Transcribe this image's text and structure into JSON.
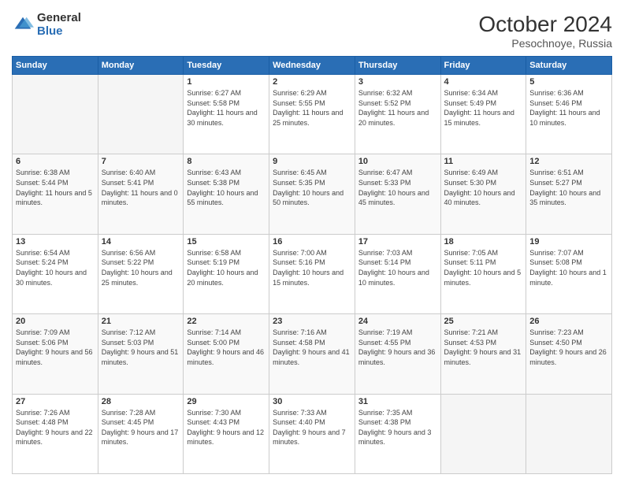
{
  "logo": {
    "general": "General",
    "blue": "Blue"
  },
  "title": "October 2024",
  "location": "Pesochnoye, Russia",
  "headers": [
    "Sunday",
    "Monday",
    "Tuesday",
    "Wednesday",
    "Thursday",
    "Friday",
    "Saturday"
  ],
  "weeks": [
    [
      {
        "day": "",
        "sunrise": "",
        "sunset": "",
        "daylight": ""
      },
      {
        "day": "",
        "sunrise": "",
        "sunset": "",
        "daylight": ""
      },
      {
        "day": "1",
        "sunrise": "Sunrise: 6:27 AM",
        "sunset": "Sunset: 5:58 PM",
        "daylight": "Daylight: 11 hours and 30 minutes."
      },
      {
        "day": "2",
        "sunrise": "Sunrise: 6:29 AM",
        "sunset": "Sunset: 5:55 PM",
        "daylight": "Daylight: 11 hours and 25 minutes."
      },
      {
        "day": "3",
        "sunrise": "Sunrise: 6:32 AM",
        "sunset": "Sunset: 5:52 PM",
        "daylight": "Daylight: 11 hours and 20 minutes."
      },
      {
        "day": "4",
        "sunrise": "Sunrise: 6:34 AM",
        "sunset": "Sunset: 5:49 PM",
        "daylight": "Daylight: 11 hours and 15 minutes."
      },
      {
        "day": "5",
        "sunrise": "Sunrise: 6:36 AM",
        "sunset": "Sunset: 5:46 PM",
        "daylight": "Daylight: 11 hours and 10 minutes."
      }
    ],
    [
      {
        "day": "6",
        "sunrise": "Sunrise: 6:38 AM",
        "sunset": "Sunset: 5:44 PM",
        "daylight": "Daylight: 11 hours and 5 minutes."
      },
      {
        "day": "7",
        "sunrise": "Sunrise: 6:40 AM",
        "sunset": "Sunset: 5:41 PM",
        "daylight": "Daylight: 11 hours and 0 minutes."
      },
      {
        "day": "8",
        "sunrise": "Sunrise: 6:43 AM",
        "sunset": "Sunset: 5:38 PM",
        "daylight": "Daylight: 10 hours and 55 minutes."
      },
      {
        "day": "9",
        "sunrise": "Sunrise: 6:45 AM",
        "sunset": "Sunset: 5:35 PM",
        "daylight": "Daylight: 10 hours and 50 minutes."
      },
      {
        "day": "10",
        "sunrise": "Sunrise: 6:47 AM",
        "sunset": "Sunset: 5:33 PM",
        "daylight": "Daylight: 10 hours and 45 minutes."
      },
      {
        "day": "11",
        "sunrise": "Sunrise: 6:49 AM",
        "sunset": "Sunset: 5:30 PM",
        "daylight": "Daylight: 10 hours and 40 minutes."
      },
      {
        "day": "12",
        "sunrise": "Sunrise: 6:51 AM",
        "sunset": "Sunset: 5:27 PM",
        "daylight": "Daylight: 10 hours and 35 minutes."
      }
    ],
    [
      {
        "day": "13",
        "sunrise": "Sunrise: 6:54 AM",
        "sunset": "Sunset: 5:24 PM",
        "daylight": "Daylight: 10 hours and 30 minutes."
      },
      {
        "day": "14",
        "sunrise": "Sunrise: 6:56 AM",
        "sunset": "Sunset: 5:22 PM",
        "daylight": "Daylight: 10 hours and 25 minutes."
      },
      {
        "day": "15",
        "sunrise": "Sunrise: 6:58 AM",
        "sunset": "Sunset: 5:19 PM",
        "daylight": "Daylight: 10 hours and 20 minutes."
      },
      {
        "day": "16",
        "sunrise": "Sunrise: 7:00 AM",
        "sunset": "Sunset: 5:16 PM",
        "daylight": "Daylight: 10 hours and 15 minutes."
      },
      {
        "day": "17",
        "sunrise": "Sunrise: 7:03 AM",
        "sunset": "Sunset: 5:14 PM",
        "daylight": "Daylight: 10 hours and 10 minutes."
      },
      {
        "day": "18",
        "sunrise": "Sunrise: 7:05 AM",
        "sunset": "Sunset: 5:11 PM",
        "daylight": "Daylight: 10 hours and 5 minutes."
      },
      {
        "day": "19",
        "sunrise": "Sunrise: 7:07 AM",
        "sunset": "Sunset: 5:08 PM",
        "daylight": "Daylight: 10 hours and 1 minute."
      }
    ],
    [
      {
        "day": "20",
        "sunrise": "Sunrise: 7:09 AM",
        "sunset": "Sunset: 5:06 PM",
        "daylight": "Daylight: 9 hours and 56 minutes."
      },
      {
        "day": "21",
        "sunrise": "Sunrise: 7:12 AM",
        "sunset": "Sunset: 5:03 PM",
        "daylight": "Daylight: 9 hours and 51 minutes."
      },
      {
        "day": "22",
        "sunrise": "Sunrise: 7:14 AM",
        "sunset": "Sunset: 5:00 PM",
        "daylight": "Daylight: 9 hours and 46 minutes."
      },
      {
        "day": "23",
        "sunrise": "Sunrise: 7:16 AM",
        "sunset": "Sunset: 4:58 PM",
        "daylight": "Daylight: 9 hours and 41 minutes."
      },
      {
        "day": "24",
        "sunrise": "Sunrise: 7:19 AM",
        "sunset": "Sunset: 4:55 PM",
        "daylight": "Daylight: 9 hours and 36 minutes."
      },
      {
        "day": "25",
        "sunrise": "Sunrise: 7:21 AM",
        "sunset": "Sunset: 4:53 PM",
        "daylight": "Daylight: 9 hours and 31 minutes."
      },
      {
        "day": "26",
        "sunrise": "Sunrise: 7:23 AM",
        "sunset": "Sunset: 4:50 PM",
        "daylight": "Daylight: 9 hours and 26 minutes."
      }
    ],
    [
      {
        "day": "27",
        "sunrise": "Sunrise: 7:26 AM",
        "sunset": "Sunset: 4:48 PM",
        "daylight": "Daylight: 9 hours and 22 minutes."
      },
      {
        "day": "28",
        "sunrise": "Sunrise: 7:28 AM",
        "sunset": "Sunset: 4:45 PM",
        "daylight": "Daylight: 9 hours and 17 minutes."
      },
      {
        "day": "29",
        "sunrise": "Sunrise: 7:30 AM",
        "sunset": "Sunset: 4:43 PM",
        "daylight": "Daylight: 9 hours and 12 minutes."
      },
      {
        "day": "30",
        "sunrise": "Sunrise: 7:33 AM",
        "sunset": "Sunset: 4:40 PM",
        "daylight": "Daylight: 9 hours and 7 minutes."
      },
      {
        "day": "31",
        "sunrise": "Sunrise: 7:35 AM",
        "sunset": "Sunset: 4:38 PM",
        "daylight": "Daylight: 9 hours and 3 minutes."
      },
      {
        "day": "",
        "sunrise": "",
        "sunset": "",
        "daylight": ""
      },
      {
        "day": "",
        "sunrise": "",
        "sunset": "",
        "daylight": ""
      }
    ]
  ]
}
